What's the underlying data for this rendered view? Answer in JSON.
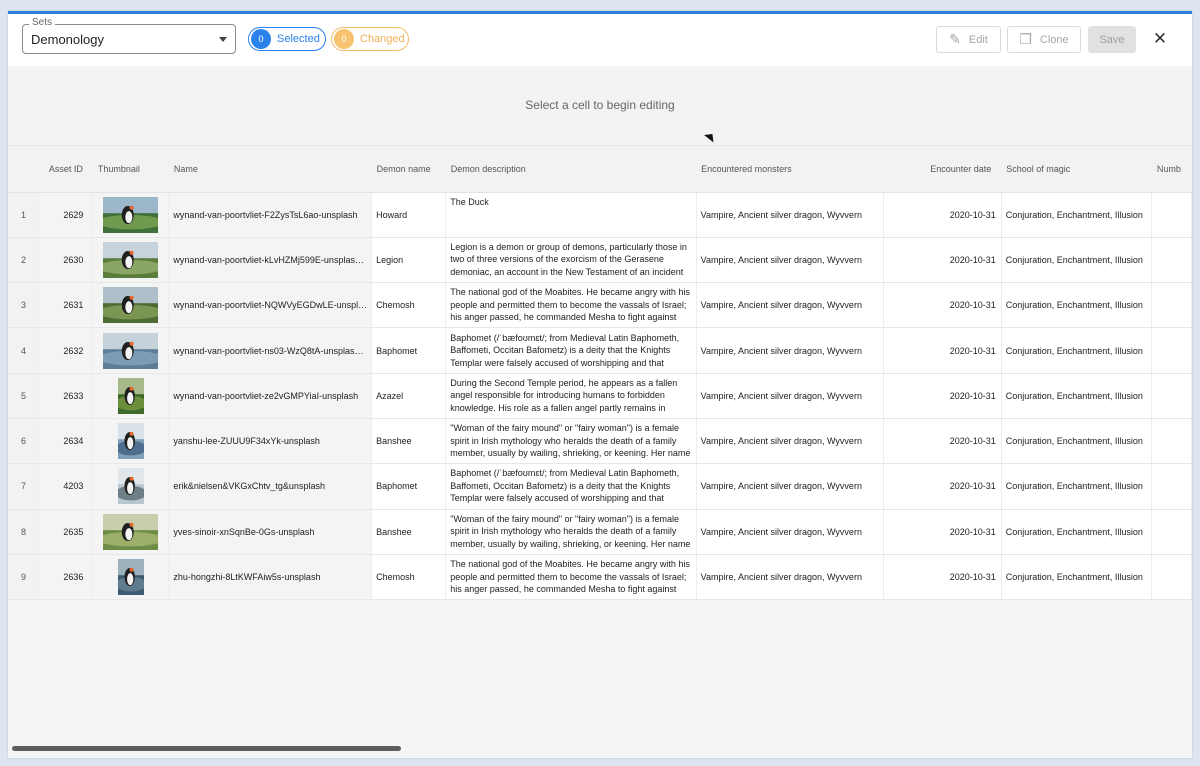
{
  "toolbar": {
    "sets_legend": "Sets",
    "sets_value": "Demonology",
    "selected_count": "0",
    "selected_label": "Selected",
    "changed_count": "0",
    "changed_label": "Changed",
    "edit_label": "Edit",
    "clone_label": "Clone",
    "save_label": "Save",
    "close_glyph": "✕"
  },
  "banner": {
    "message": "Select a cell to begin editing"
  },
  "colors": {
    "accent": "#2f7fe0",
    "selected_chip": "#2b82ea",
    "changed_chip": "#f7c371"
  },
  "table": {
    "columns": [
      "",
      "Asset ID",
      "Thumbnail",
      "Name",
      "Demon name",
      "Demon description",
      "Encountered monsters",
      "Encounter date",
      "School of magic",
      "Numb"
    ],
    "rows": [
      {
        "index": "1",
        "asset_id": "2629",
        "thumb": "landscape",
        "name": "wynand-van-poortvliet-F2ZysTsL6ao-unsplash",
        "demon": "Howard",
        "desc": "The Duck",
        "monsters": "Vampire, Ancient silver dragon, Wyvvern",
        "date": "2020-10-31",
        "school": "Conjuration, Enchantment, Illusion"
      },
      {
        "index": "2",
        "asset_id": "2630",
        "thumb": "landscape",
        "name": "wynand-van-poortvliet-kLvHZMj599E-unsplas…",
        "demon": "Legion",
        "desc": "Legion is a demon or group of demons, particularly those in two of three versions of the exorcism of the Gerasene demoniac, an account in the New Testament of an incident in which Jesus performs an exorcism.",
        "monsters": "Vampire, Ancient silver dragon, Wyvvern",
        "date": "2020-10-31",
        "school": "Conjuration, Enchantment, Illusion"
      },
      {
        "index": "3",
        "asset_id": "2631",
        "thumb": "landscape",
        "name": "wynand-van-poortvliet-NQWVyEGDwLE-unspl…",
        "demon": "Chemosh",
        "desc": "The national god of the Moabites. He became angry with his people and permitted them to become the vassals of Israel; his anger passed, he commanded Mesha to fight against Israel, and Moabitish independence was reestablished (Moabite Stone",
        "monsters": "Vampire, Ancient silver dragon, Wyvvern",
        "date": "2020-10-31",
        "school": "Conjuration, Enchantment, Illusion"
      },
      {
        "index": "4",
        "asset_id": "2632",
        "thumb": "landscape",
        "name": "wynand-van-poortvliet-ns03-WzQ8tA-unsplas…",
        "demon": "Baphomet",
        "desc": "Baphomet (/ˈbæfoʊmɛt/; from Medieval Latin Baphometh, Baffometi, Occitan Bafometz) is a deity that the Knights Templar were falsely accused of worshipping and that subsequently was incorporated into disparate occult and",
        "monsters": "Vampire, Ancient silver dragon, Wyvvern",
        "date": "2020-10-31",
        "school": "Conjuration, Enchantment, Illusion"
      },
      {
        "index": "5",
        "asset_id": "2633",
        "thumb": "portrait",
        "name": "wynand-van-poortvliet-ze2vGMPYiaI-unsplash",
        "demon": "Azazel",
        "desc": "During the Second Temple period, he appears as a fallen angel responsible for introducing humans to forbidden knowledge. His role as a fallen angel partly remains in Christian– and Islamic traditions. In Islam, he is often, but not exclusively",
        "monsters": "Vampire, Ancient silver dragon, Wyvvern",
        "date": "2020-10-31",
        "school": "Conjuration, Enchantment, Illusion"
      },
      {
        "index": "6",
        "asset_id": "2634",
        "thumb": "portrait",
        "name": "yanshu-lee-ZUUU9F34xYk-unsplash",
        "demon": "Banshee",
        "desc": "\"Woman of the fairy mound\" or \"fairy woman\") is a female spirit in Irish mythology who heralds the death of a family member, usually by wailing, shrieking, or keening. Her name is connected to the mythologically important tumuli or \"mounds\"",
        "monsters": "Vampire, Ancient silver dragon, Wyvvern",
        "date": "2020-10-31",
        "school": "Conjuration, Enchantment, Illusion"
      },
      {
        "index": "7",
        "asset_id": "4203",
        "thumb": "portrait",
        "name": "erik&nielsen&VKGxChtv_tg&unsplash",
        "demon": "Baphomet",
        "desc": "Baphomet (/ˈbæfoʊmɛt/; from Medieval Latin Baphometh, Baffometi, Occitan Bafometz) is a deity that the Knights Templar were falsely accused of worshipping and that subsequently was incorporated into disparate occult and",
        "monsters": "Vampire, Ancient silver dragon, Wyvvern",
        "date": "2020-10-31",
        "school": "Conjuration, Enchantment, Illusion"
      },
      {
        "index": "8",
        "asset_id": "2635",
        "thumb": "landscape",
        "name": "yves-sinoir-xnSqnBe-0Gs-unsplash",
        "demon": "Banshee",
        "desc": "\"Woman of the fairy mound\" or \"fairy woman\") is a female spirit in Irish mythology who heralds the death of a family member, usually by wailing, shrieking, or keening. Her name is connected to the mythologically important tumuli or \"mounds\"",
        "monsters": "Vampire, Ancient silver dragon, Wyvvern",
        "date": "2020-10-31",
        "school": "Conjuration, Enchantment, Illusion"
      },
      {
        "index": "9",
        "asset_id": "2636",
        "thumb": "portrait",
        "name": "zhu-hongzhi-8LtKWFAiw5s-unsplash",
        "demon": "Chemosh",
        "desc": "The national god of the Moabites. He became angry with his people and permitted them to become the vassals of Israel; his anger passed, he commanded Mesha to fight against Israel, and Moabitish independence was reestablished (Moabite Stone",
        "monsters": "Vampire, Ancient silver dragon, Wyvvern",
        "date": "2020-10-31",
        "school": "Conjuration, Enchantment, Illusion"
      }
    ]
  }
}
